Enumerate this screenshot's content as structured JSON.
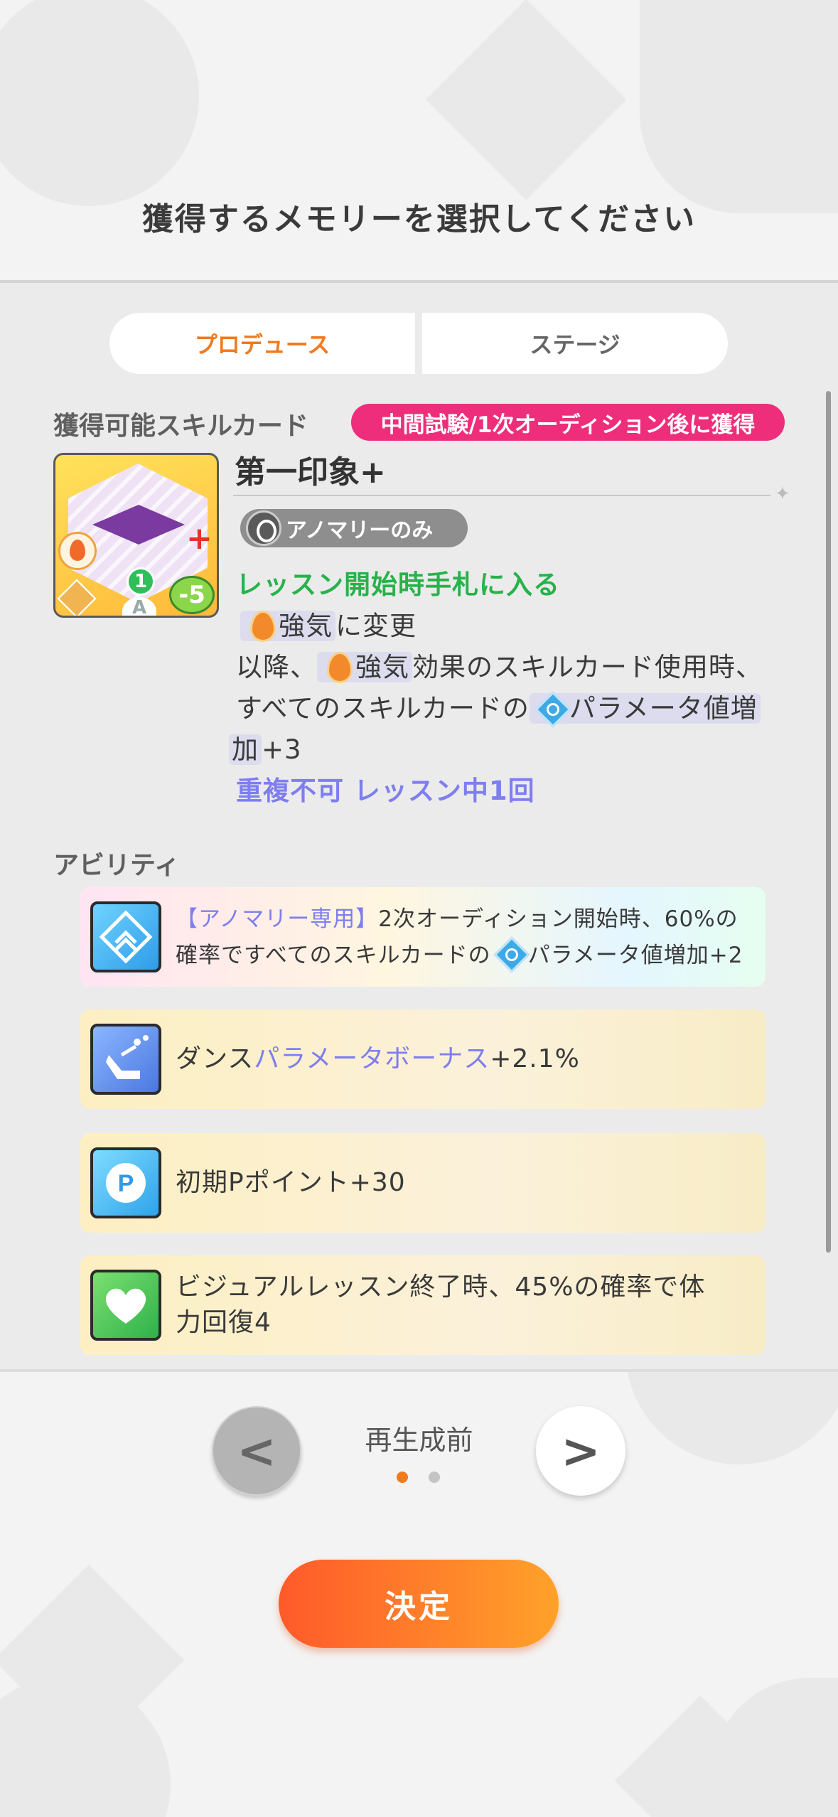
{
  "header": {
    "title": "獲得するメモリーを選択してください"
  },
  "tabs": [
    {
      "label": "プロデュース",
      "active": true
    },
    {
      "label": "ステージ",
      "active": false
    }
  ],
  "skill_section": {
    "label": "獲得可能スキルカード",
    "badge": "中間試験/1次オーディション後に獲得",
    "card": {
      "cost": "-5",
      "level": "1",
      "rank": "A"
    },
    "name": "第一印象+",
    "tag": "アノマリーのみ",
    "effects": {
      "line1": "レッスン開始時手札に入る",
      "line2_kw": "強気",
      "line2_rest": "に変更",
      "line3_pre": "以降、",
      "line3_kw": "強気",
      "line3_rest": "効果のスキルカード使用時、",
      "line4_pre": "すべてのスキルカードの",
      "line4_kw": "パラメータ値増",
      "line5_kw": "加",
      "line5_rest": "+3",
      "line6": "重複不可 レッスン中1回"
    }
  },
  "ability_section": {
    "label": "アビリティ",
    "items": [
      {
        "icon": "anomaly-chevron-icon",
        "prefix": "【アノマリー専用】",
        "text1": "2次オーディション開始時、60%の",
        "text2_pre": "確率ですべてのスキルカードの",
        "text2_post": "パラメータ値増加+2"
      },
      {
        "icon": "dance-icon",
        "pre": "ダンス",
        "kw": "パラメータボーナス",
        "post": "+2.1%"
      },
      {
        "icon": "p-point-icon",
        "text": "初期Pポイント+30"
      },
      {
        "icon": "heart-icon",
        "text1": "ビジュアルレッスン終了時、45%の確率で体",
        "text2": "力回復4"
      }
    ]
  },
  "pager": {
    "label": "再生成前",
    "prev": "<",
    "next": ">",
    "pages": 2,
    "current": 1
  },
  "confirm_button": "決定",
  "colors": {
    "accent_orange": "#f07a1e",
    "badge_pink": "#ee2e7a",
    "green": "#28b24b",
    "lavender": "#7e7ef0"
  }
}
